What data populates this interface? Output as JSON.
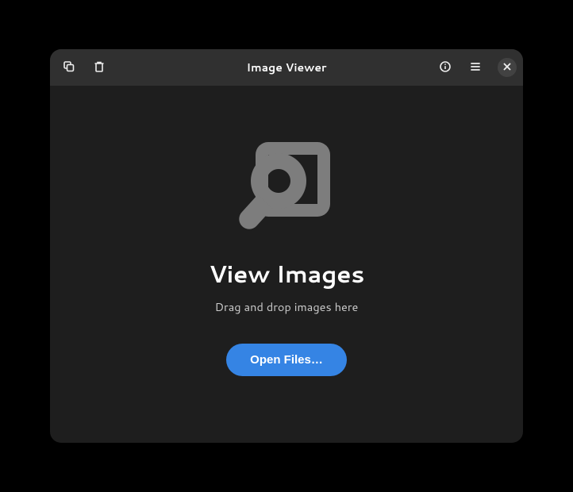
{
  "header": {
    "title": "Image Viewer"
  },
  "main": {
    "heading": "View Images",
    "subheading": "Drag and drop images here",
    "open_button_label": "Open Files…"
  }
}
